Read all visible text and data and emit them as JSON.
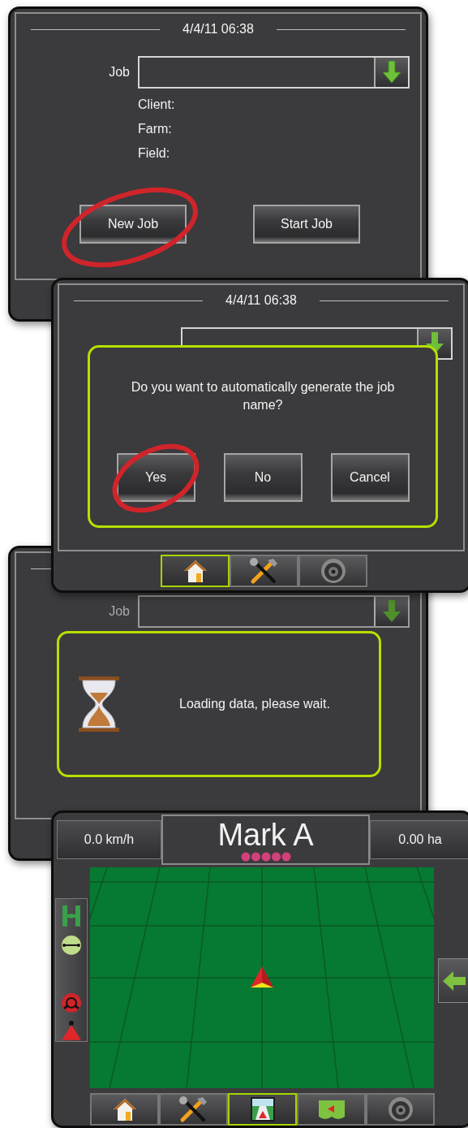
{
  "screens": [
    {
      "kind": "job_select",
      "date": "4/4/11 06:38",
      "job_label": "Job",
      "info_labels": [
        "Client:",
        "Farm:",
        "Field:"
      ],
      "buttons": [
        {
          "label": "New Job",
          "circled": true
        },
        {
          "label": "Start Job",
          "circled": false
        }
      ]
    },
    {
      "kind": "confirm",
      "date": "4/4/11 06:38",
      "message": "Do you want to automatically generate the job name?",
      "buttons": [
        {
          "label": "Yes",
          "circled": true
        },
        {
          "label": "No",
          "circled": false
        },
        {
          "label": "Cancel",
          "circled": false
        }
      ],
      "nav_tabs": [
        {
          "kind": "home",
          "selected": true
        },
        {
          "kind": "tools",
          "selected": false
        },
        {
          "kind": "camera",
          "selected": false
        }
      ]
    },
    {
      "kind": "loading",
      "job_label": "Job",
      "message": "Loading data, please wait."
    },
    {
      "kind": "guidance",
      "speed": "0.0 km/h",
      "title": "Mark A",
      "area": "0.00 ha",
      "nav_tabs": [
        {
          "kind": "home",
          "selected": false
        },
        {
          "kind": "tools",
          "selected": false
        },
        {
          "kind": "guidance",
          "selected": true
        },
        {
          "kind": "map",
          "selected": false
        },
        {
          "kind": "camera",
          "selected": false
        }
      ]
    }
  ]
}
